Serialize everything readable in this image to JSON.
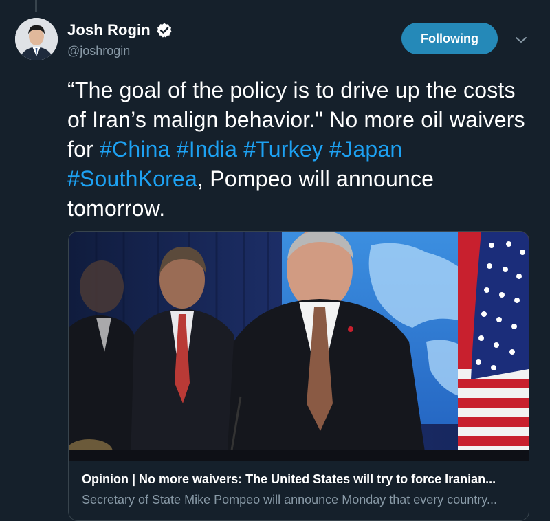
{
  "tweet": {
    "author": {
      "name": "Josh Rogin",
      "handle": "@joshrogin",
      "verified": true
    },
    "follow_button_label": "Following",
    "text": {
      "p1": "“The goal of the policy is to drive up the costs of Iran’s malign behavior.\" No more oil waivers for ",
      "hashtags": [
        "#China",
        "#India",
        "#Turkey",
        "#Japan",
        "#SouthKorea"
      ],
      "p2": ", Pompeo will announce tomorrow."
    },
    "card": {
      "title": "Opinion | No more waivers: The United States will try to force Iranian...",
      "description": "Secretary of State Mike Pompeo will announce Monday that every country..."
    }
  },
  "colors": {
    "background": "#15202b",
    "hashtag": "#1da1f2",
    "secondary_text": "#8899a6",
    "follow_button": "#2589b8"
  },
  "icons": {
    "verified": "verified-badge-icon",
    "caret": "chevron-down-icon"
  }
}
